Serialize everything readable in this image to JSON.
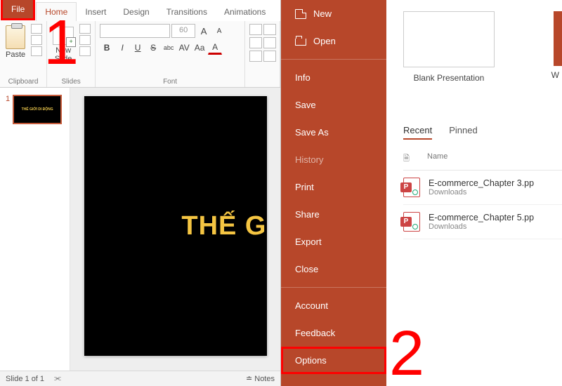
{
  "tabs": {
    "file": "File",
    "home": "Home",
    "insert": "Insert",
    "design": "Design",
    "transitions": "Transitions",
    "animations": "Animations"
  },
  "ribbon": {
    "clipboard": {
      "label": "Clipboard",
      "paste": "Paste"
    },
    "slides": {
      "label": "Slides",
      "newSlide": "New\nSlide"
    },
    "font": {
      "label": "Font",
      "sizePlaceholder": "60",
      "bold": "B",
      "italic": "I",
      "underline": "U",
      "strike": "S",
      "shadow": "abc",
      "grow": "A",
      "shrink": "A",
      "clear": "Aa"
    }
  },
  "thumb": {
    "num": "1",
    "text": "THẾ GIỚI DI ĐỘNG"
  },
  "slideTitle": "THẾ G",
  "status": {
    "slide": "Slide 1 of 1",
    "notes": "Notes"
  },
  "markers": {
    "one": "1",
    "two": "2"
  },
  "fileMenu": {
    "new": "New",
    "open": "Open",
    "info": "Info",
    "save": "Save",
    "saveAs": "Save As",
    "history": "History",
    "print": "Print",
    "share": "Share",
    "export": "Export",
    "close": "Close",
    "account": "Account",
    "feedback": "Feedback",
    "options": "Options"
  },
  "backstage": {
    "blank": "Blank Presentation",
    "cutoff": "W",
    "recentTabs": {
      "recent": "Recent",
      "pinned": "Pinned"
    },
    "headName": "Name",
    "files": [
      {
        "name": "E-commerce_Chapter 3.pp",
        "sub": "Downloads"
      },
      {
        "name": "E-commerce_Chapter 5.pp",
        "sub": "Downloads"
      }
    ]
  }
}
